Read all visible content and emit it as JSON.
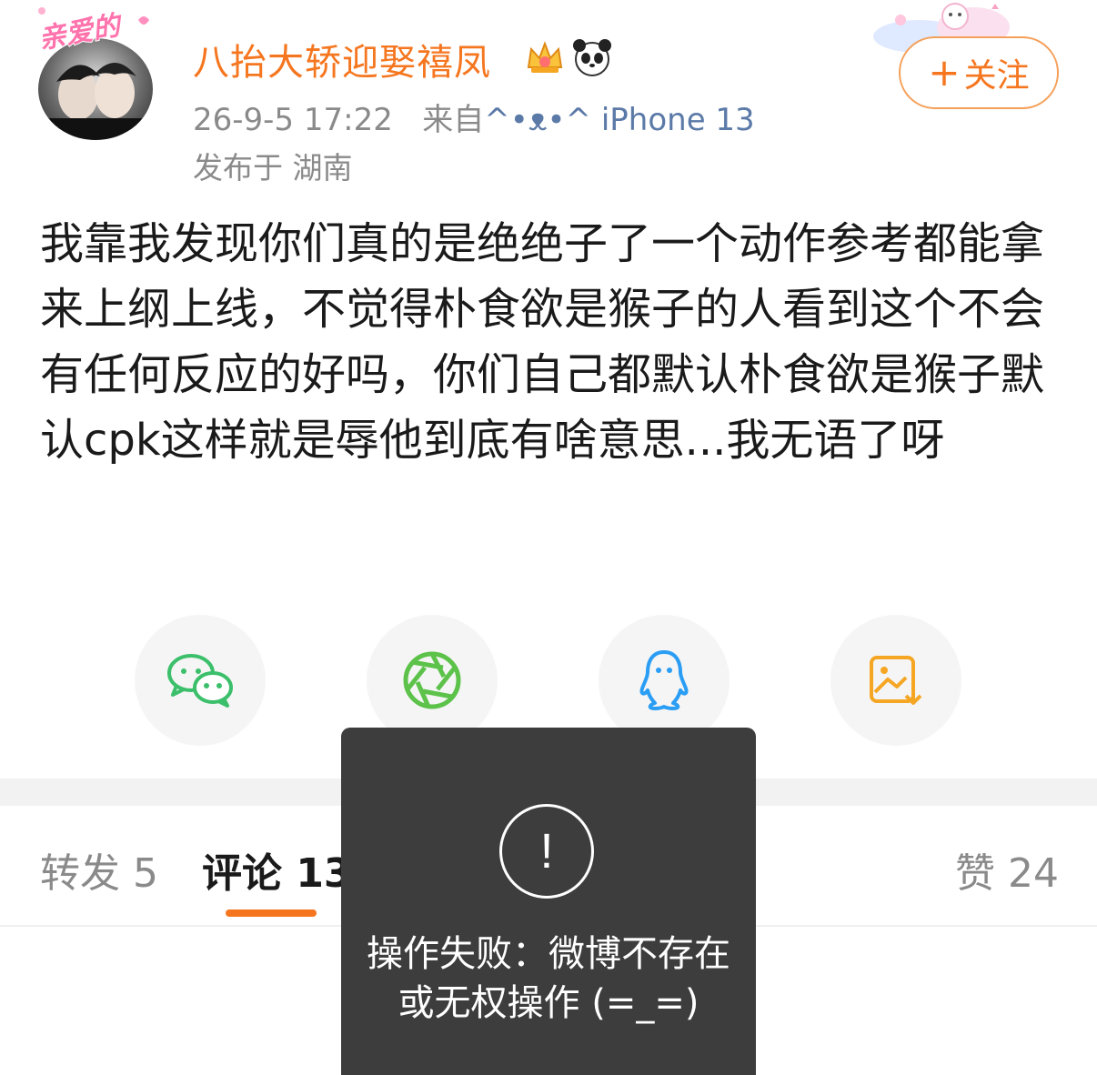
{
  "post": {
    "username": "八抬大轿迎娶禧凤",
    "avatar_frame_text": "亲爱的",
    "badges": [
      "crown-badge-icon",
      "panda-icon"
    ],
    "time": "26-9-5 17:22",
    "source_prefix": "来自",
    "source_face": "^•ᴥ•^",
    "source_device": "iPhone 13",
    "location": "发布于 湖南",
    "follow_label": "关注",
    "follow_plus": "+",
    "content": "我靠我发现你们真的是绝绝子了一个动作参考都能拿来上纲上线，不觉得朴食欲是猴子的人看到这个不会有任何反应的好吗，你们自己都默认朴食欲是猴子默认cpk这样就是辱他到底有啥意思...我无语了呀"
  },
  "share": {
    "items": [
      {
        "name": "wechat-icon",
        "color": "#3bbf6a"
      },
      {
        "name": "moments-icon",
        "color": "#5cc24a"
      },
      {
        "name": "qq-icon",
        "color": "#2a9df4"
      },
      {
        "name": "save-image-icon",
        "color": "#f5a623"
      }
    ]
  },
  "tabs": {
    "repost": "转发 5",
    "comments": "评论 13",
    "likes": "赞 24"
  },
  "toast": {
    "icon": "!",
    "message": "操作失败：微博不存在或无权操作 (=_=)"
  },
  "colors": {
    "accent": "#f5761f",
    "toast_bg": "#3d3d3d"
  }
}
